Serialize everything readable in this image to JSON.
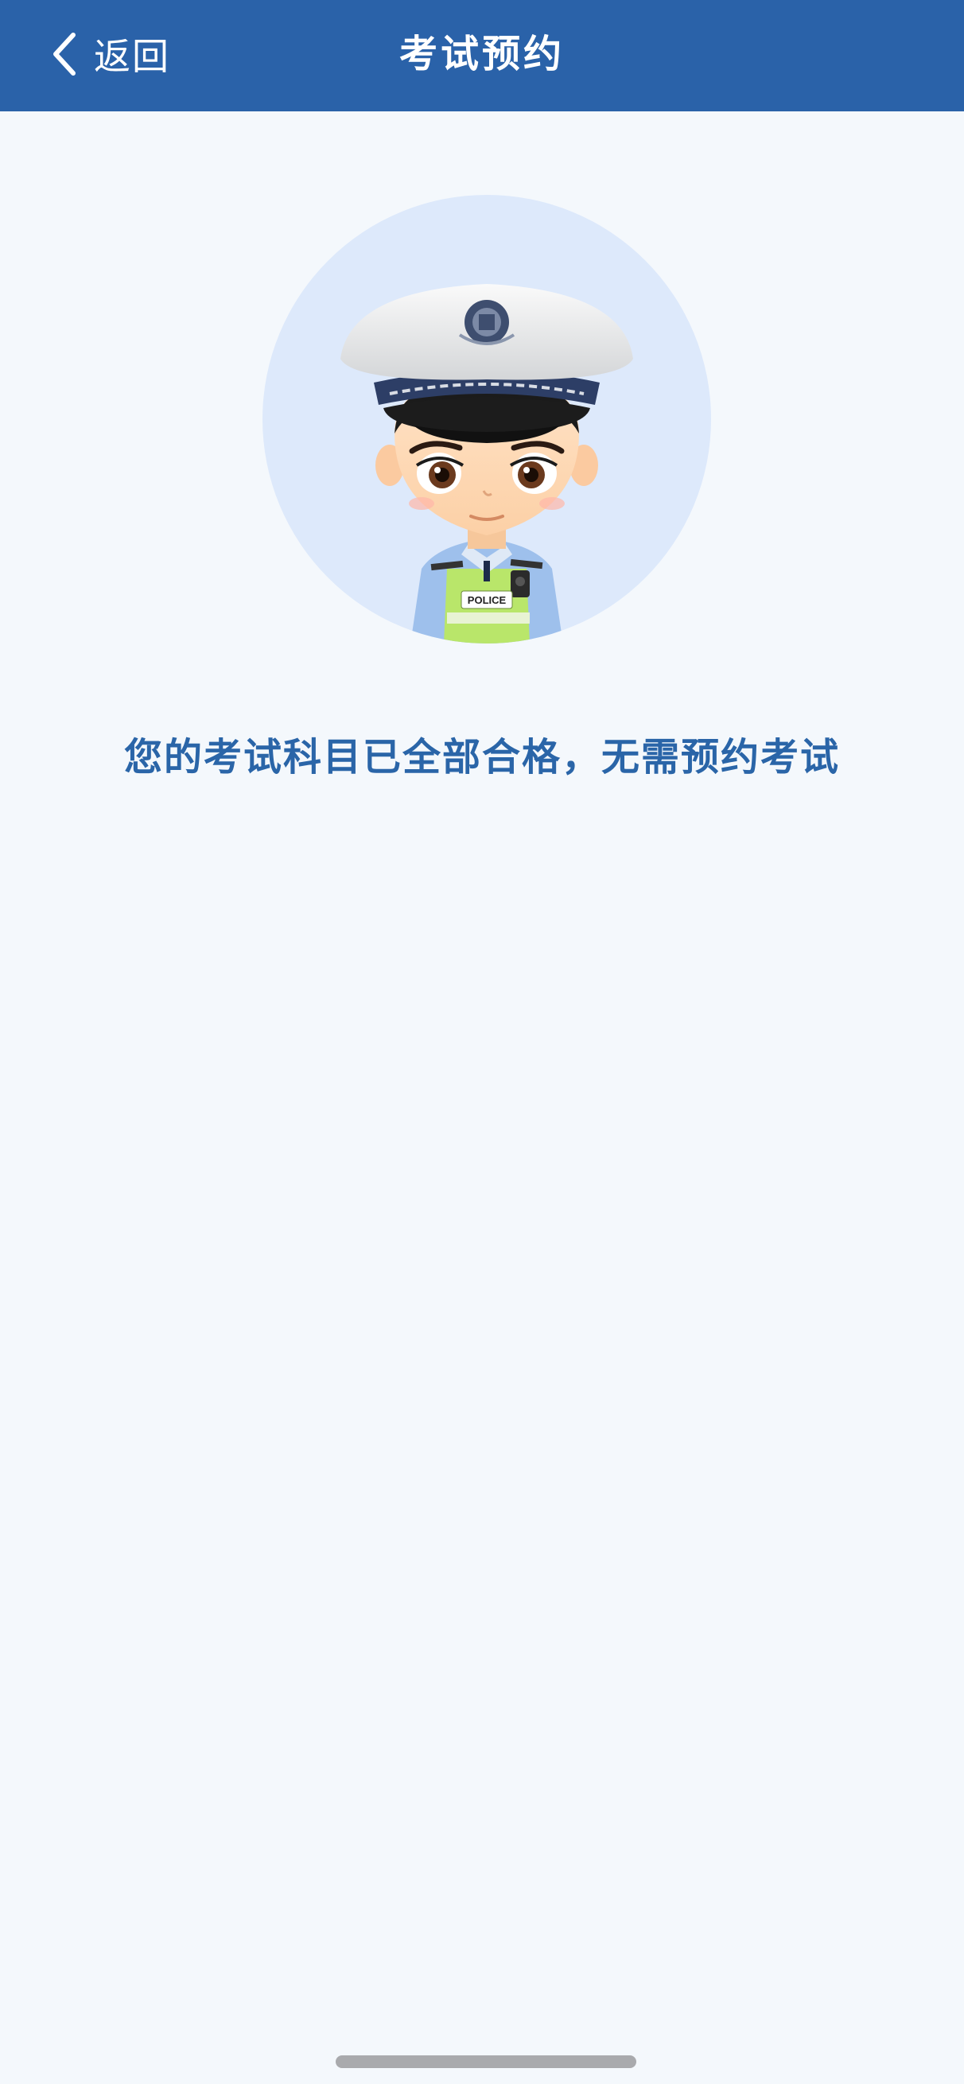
{
  "header": {
    "back_label": "返回",
    "title": "考试预约",
    "back_icon": "chevron-left-icon",
    "background_color": "#2a62a9"
  },
  "main": {
    "illustration": "police-officer-avatar",
    "badge_text": "POLICE",
    "message": "您的考试科目已全部合格，无需预约考试",
    "message_color": "#2a65a8",
    "circle_color": "#dde9fb"
  }
}
